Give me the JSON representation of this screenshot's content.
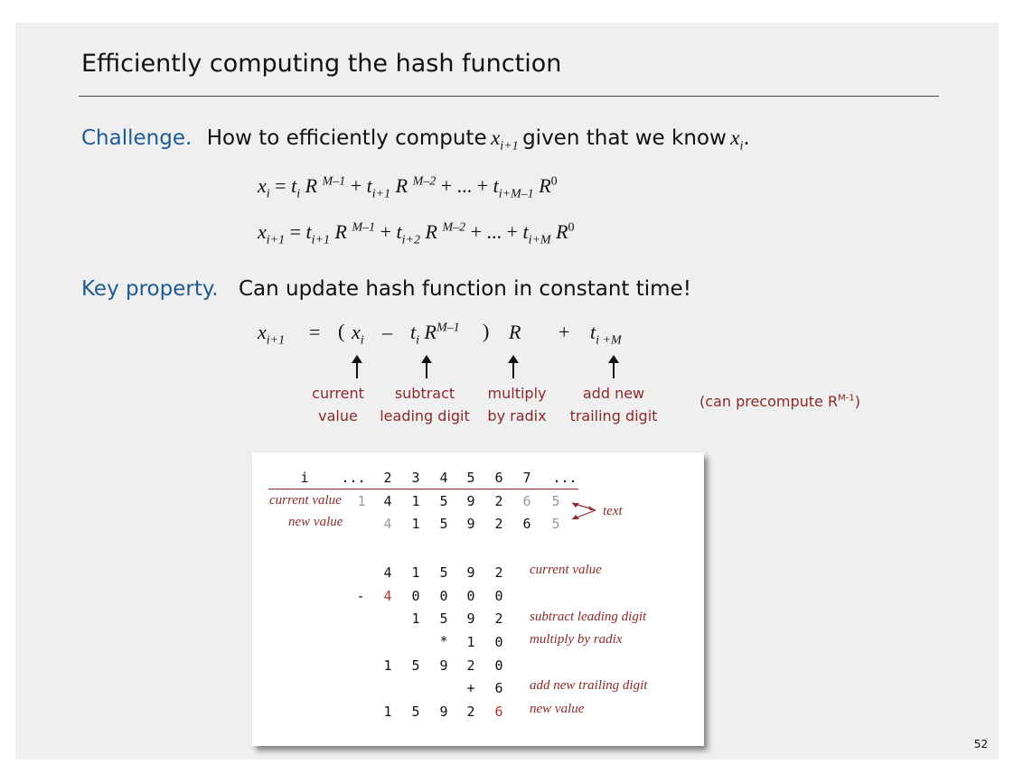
{
  "title": "Efficiently computing the hash function",
  "challenge": {
    "label": "Challenge.",
    "text_before": "How to efficiently compute",
    "var1": "x",
    "var1_sub": "i+1",
    "text_after": "given that we know",
    "var2": "x",
    "var2_sub": "i",
    "period": "."
  },
  "eq1": {
    "lhs": "x",
    "lhs_sub": "i",
    "eq": " = ",
    "t1": "t",
    "t1_sub": "i",
    "r1": " R ",
    "r1_sup": "M–1",
    "plus1": " + ",
    "t2": "t",
    "t2_sub": "i+1",
    "r2": " R ",
    "r2_sup": "M–2",
    "mid": " + ... + ",
    "t3": "t",
    "t3_sub": "i+M–1",
    "r3": " R",
    "r3_sup": "0"
  },
  "eq2": {
    "lhs": "x",
    "lhs_sub": "i+1",
    "eq": " = ",
    "t1": "t",
    "t1_sub": "i+1",
    "r1": " R ",
    "r1_sup": "M–1",
    "plus1": " + ",
    "t2": "t",
    "t2_sub": "i+2",
    "r2": " R ",
    "r2_sup": "M–2",
    "mid": " + ... + ",
    "t3": "t",
    "t3_sub": "i+M",
    "r3": " R",
    "r3_sup": "0"
  },
  "key": {
    "label": "Key property.",
    "text": "Can update hash function in constant time!"
  },
  "update_eq": {
    "lhs": "x",
    "lhs_sub": "i+1",
    "eq": "=",
    "open": "(",
    "xi": "x",
    "xi_sub": "i",
    "minus": "–",
    "t": "t",
    "t_sub": "i",
    "r": " R",
    "r_sup": "M–1",
    "close": ")",
    "mult_r": "R",
    "plus": "+",
    "t2": "t",
    "t2_sub": "i +M"
  },
  "annotations": [
    {
      "line1": "current",
      "line2": "value"
    },
    {
      "line1": "subtract",
      "line2": "leading digit"
    },
    {
      "line1": "multiply",
      "line2": "by radix"
    },
    {
      "line1": "add new",
      "line2": "trailing digit"
    }
  ],
  "precompute": {
    "text": "(can precompute R",
    "sup": "M-1",
    "close": ")"
  },
  "table": {
    "header_i": "i",
    "header_dots1": "...",
    "header_nums": [
      "2",
      "3",
      "4",
      "5",
      "6",
      "7"
    ],
    "header_dots2": "...",
    "current_value_label": "current value",
    "current_value_lead": "1",
    "current_value_digits": [
      "4",
      "1",
      "5",
      "9",
      "2"
    ],
    "current_value_tail": [
      "6",
      "5"
    ],
    "new_value_label": "new value",
    "new_value_lead": "4",
    "new_value_digits": [
      "1",
      "5",
      "9",
      "2",
      "6"
    ],
    "new_value_tail": "5",
    "text_label": "text"
  },
  "calc": {
    "row1": [
      "4",
      "1",
      "5",
      "9",
      "2"
    ],
    "row1_label": "current value",
    "minus_sign": "-",
    "row2_lead": "4",
    "row2": [
      "0",
      "0",
      "0",
      "0"
    ],
    "row3": [
      "1",
      "5",
      "9",
      "2"
    ],
    "row3_label": "subtract leading digit",
    "times_sign": "*",
    "row4": [
      "1",
      "0"
    ],
    "row4_label": "multiply by radix",
    "row5": [
      "1",
      "5",
      "9",
      "2",
      "0"
    ],
    "plus_sign": "+",
    "row6": [
      "6"
    ],
    "row6_label": "add new trailing digit",
    "row7": [
      "1",
      "5",
      "9",
      "2"
    ],
    "row7_last": "6",
    "row7_label": "new value"
  },
  "page_number": "52"
}
